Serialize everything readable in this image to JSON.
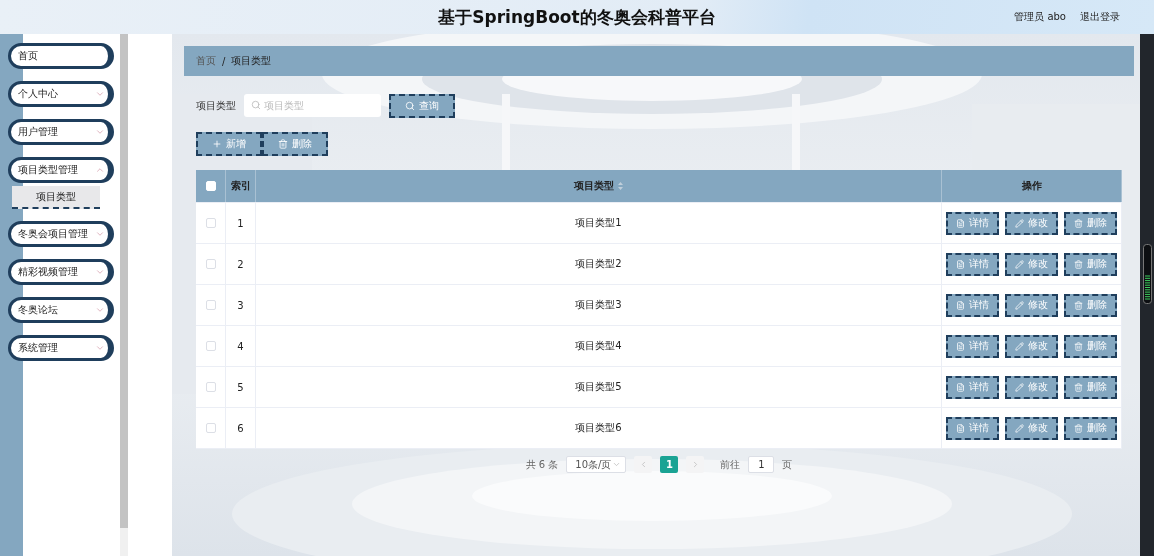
{
  "header": {
    "title": "基于SpringBoot的冬奥会科普平台",
    "user": "管理员 abo",
    "logout": "退出登录"
  },
  "sidebar": {
    "items": [
      {
        "label": "首页",
        "kind": "link"
      },
      {
        "label": "个人中心",
        "kind": "menu",
        "expanded": false
      },
      {
        "label": "用户管理",
        "kind": "menu",
        "expanded": false
      },
      {
        "label": "项目类型管理",
        "kind": "menu",
        "expanded": true,
        "children": [
          {
            "label": "项目类型",
            "selected": true
          }
        ]
      },
      {
        "label": "冬奥会项目管理",
        "kind": "menu",
        "expanded": false
      },
      {
        "label": "精彩视频管理",
        "kind": "menu",
        "expanded": false
      },
      {
        "label": "冬奥论坛",
        "kind": "menu",
        "expanded": false
      },
      {
        "label": "系统管理",
        "kind": "menu",
        "expanded": false
      }
    ]
  },
  "breadcrumb": {
    "items": [
      "首页",
      "项目类型"
    ],
    "separator": "/"
  },
  "search": {
    "label": "项目类型",
    "placeholder": "项目类型",
    "button": "查询"
  },
  "actions": [
    {
      "label": "新增",
      "kind": "add"
    },
    {
      "label": "删除",
      "kind": "delete"
    }
  ],
  "table": {
    "header_checked": false,
    "columns": [
      "索引",
      "项目类型",
      "操作"
    ],
    "rows": [
      {
        "checked": false,
        "index": "1",
        "name": "项目类型1",
        "actions": [
          {
            "label": "详情",
            "kind": "detail"
          },
          {
            "label": "修改",
            "kind": "edit"
          },
          {
            "label": "删除",
            "kind": "delete"
          }
        ]
      },
      {
        "checked": false,
        "index": "2",
        "name": "项目类型2",
        "actions": [
          {
            "label": "详情",
            "kind": "detail"
          },
          {
            "label": "修改",
            "kind": "edit"
          },
          {
            "label": "删除",
            "kind": "delete"
          }
        ]
      },
      {
        "checked": false,
        "index": "3",
        "name": "项目类型3",
        "actions": [
          {
            "label": "详情",
            "kind": "detail"
          },
          {
            "label": "修改",
            "kind": "edit"
          },
          {
            "label": "删除",
            "kind": "delete"
          }
        ]
      },
      {
        "checked": false,
        "index": "4",
        "name": "项目类型4",
        "actions": [
          {
            "label": "详情",
            "kind": "detail"
          },
          {
            "label": "修改",
            "kind": "edit"
          },
          {
            "label": "删除",
            "kind": "delete"
          }
        ]
      },
      {
        "checked": false,
        "index": "5",
        "name": "项目类型5",
        "actions": [
          {
            "label": "详情",
            "kind": "detail"
          },
          {
            "label": "修改",
            "kind": "edit"
          },
          {
            "label": "删除",
            "kind": "delete"
          }
        ]
      },
      {
        "checked": false,
        "index": "6",
        "name": "项目类型6",
        "actions": [
          {
            "label": "详情",
            "kind": "detail"
          },
          {
            "label": "修改",
            "kind": "edit"
          },
          {
            "label": "删除",
            "kind": "delete"
          }
        ]
      }
    ]
  },
  "pagination": {
    "total": "共 6 条",
    "page_size": "10条/页",
    "pages": [
      {
        "label": "1",
        "selected": true
      }
    ],
    "goto_label": "前往",
    "goto_value": "1",
    "goto_suffix": "页"
  }
}
